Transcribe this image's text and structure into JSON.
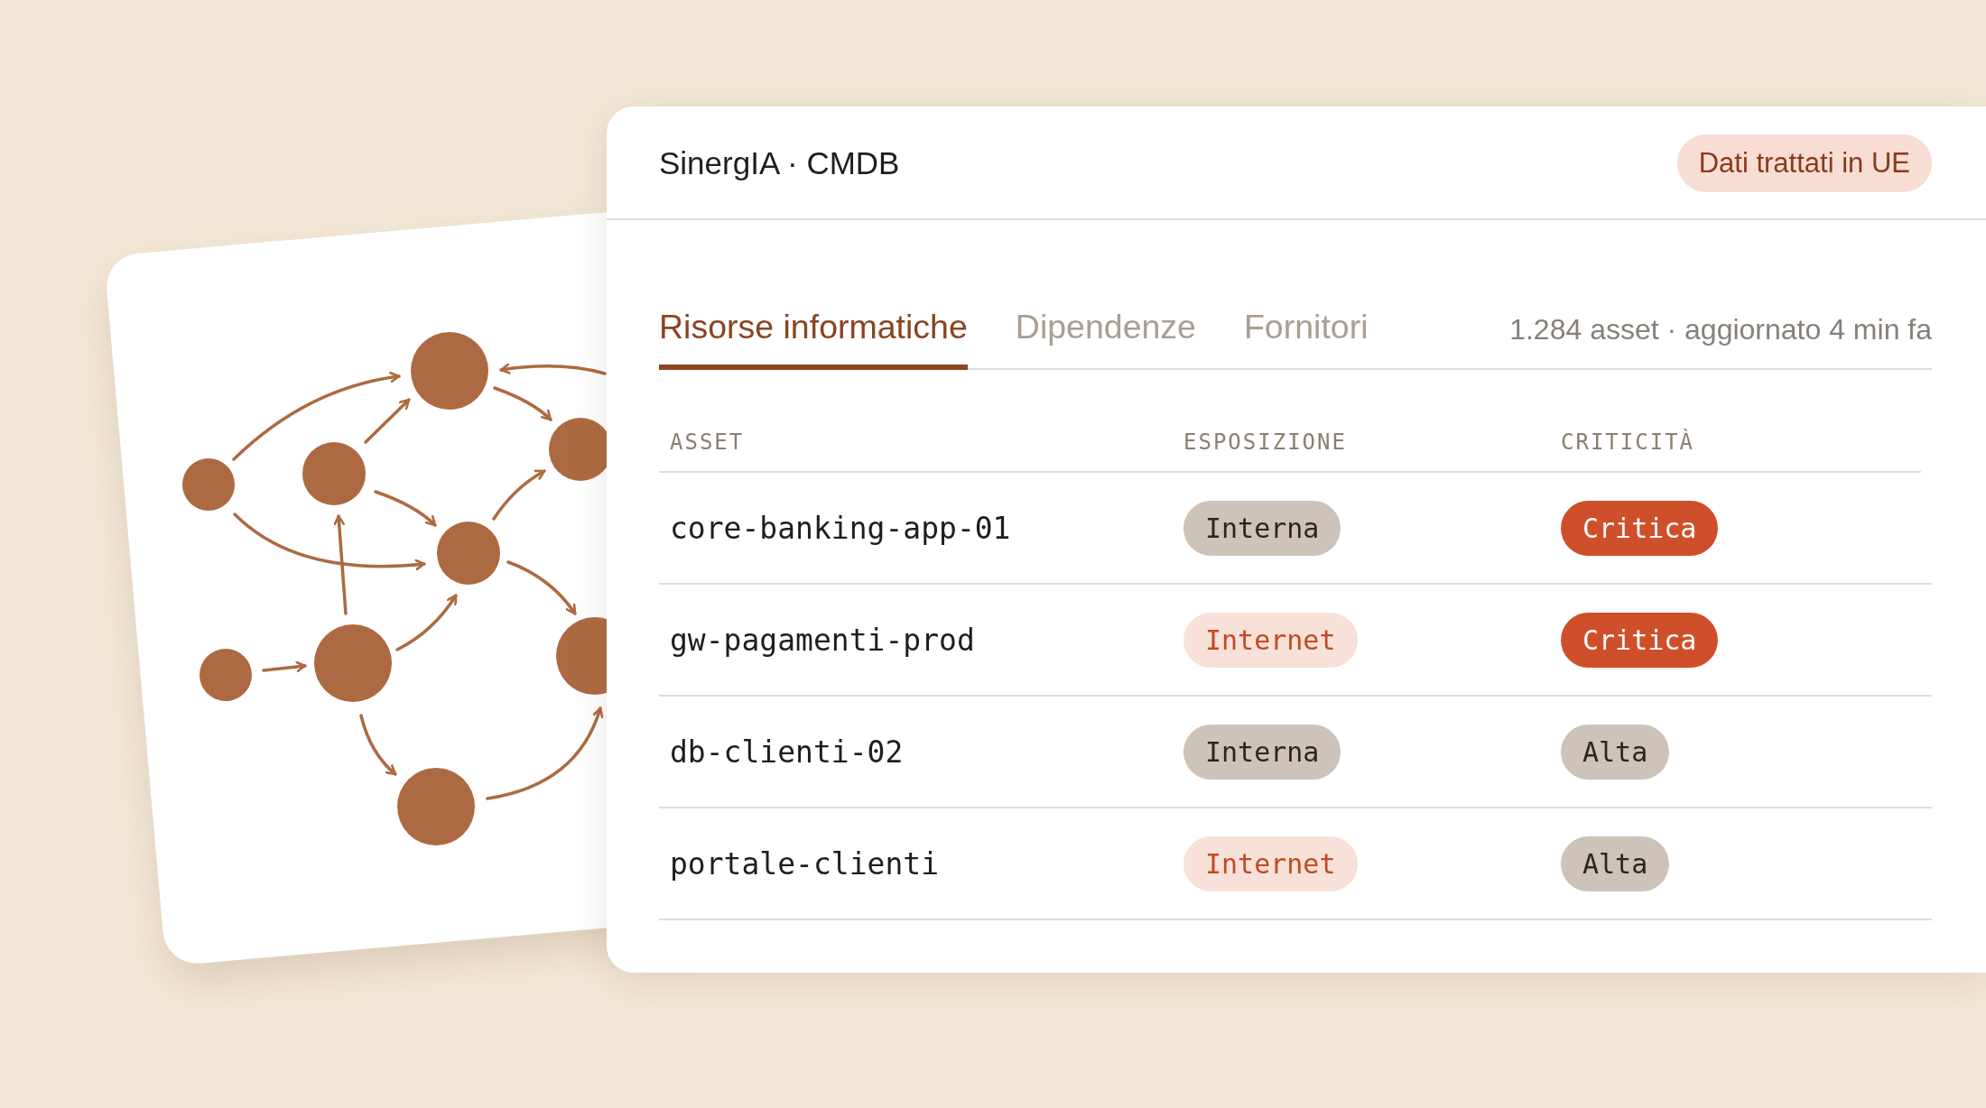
{
  "header": {
    "title": "SinergIA · CMDB",
    "badge": "Dati trattati in UE"
  },
  "tabs": [
    {
      "label": "Risorse informatiche",
      "selected": true
    },
    {
      "label": "Dipendenze",
      "selected": false
    },
    {
      "label": "Fornitori",
      "selected": false
    }
  ],
  "summary": "1.284 asset · aggiornato 4 min fa",
  "table": {
    "columns": [
      "ASSET",
      "ESPOSIZIONE",
      "CRITICITÀ"
    ],
    "rows": [
      {
        "asset": "core-banking-app-01",
        "exposure": {
          "text": "Interna",
          "kind": "neutral"
        },
        "criticality": {
          "text": "Critica",
          "kind": "strong"
        }
      },
      {
        "asset": "gw-pagamenti-prod",
        "exposure": {
          "text": "Internet",
          "kind": "soft"
        },
        "criticality": {
          "text": "Critica",
          "kind": "strong"
        }
      },
      {
        "asset": "db-clienti-02",
        "exposure": {
          "text": "Interna",
          "kind": "neutral"
        },
        "criticality": {
          "text": "Alta",
          "kind": "neutral"
        }
      },
      {
        "asset": "portale-clienti",
        "exposure": {
          "text": "Internet",
          "kind": "soft"
        },
        "criticality": {
          "text": "Alta",
          "kind": "neutral"
        }
      }
    ]
  }
}
